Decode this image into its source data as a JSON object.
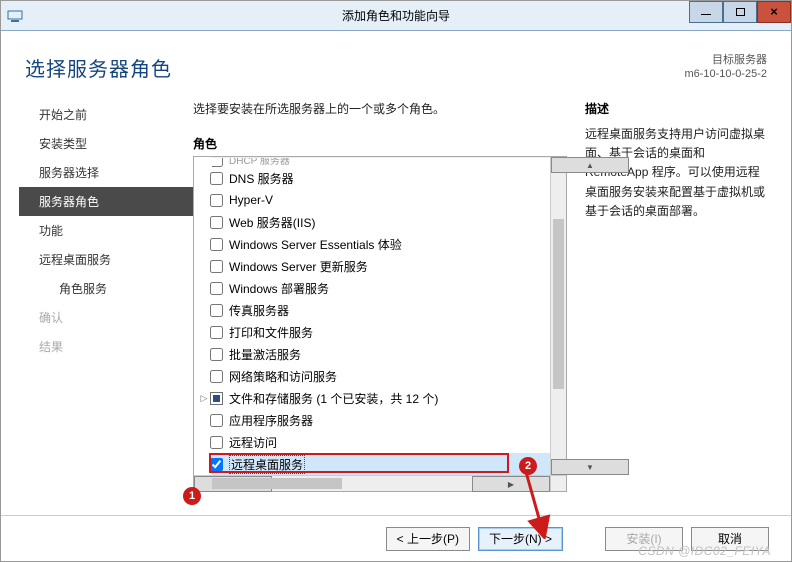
{
  "window": {
    "title": "添加角色和功能向导"
  },
  "page_heading": "选择服务器角色",
  "server_meta": {
    "label": "目标服务器",
    "name": "m6-10-10-0-25-2"
  },
  "nav": {
    "items": [
      {
        "label": "开始之前",
        "state": "normal"
      },
      {
        "label": "安装类型",
        "state": "normal"
      },
      {
        "label": "服务器选择",
        "state": "normal"
      },
      {
        "label": "服务器角色",
        "state": "active"
      },
      {
        "label": "功能",
        "state": "normal"
      },
      {
        "label": "远程桌面服务",
        "state": "normal"
      },
      {
        "label": "角色服务",
        "state": "normal",
        "indent": true
      },
      {
        "label": "确认",
        "state": "disabled"
      },
      {
        "label": "结果",
        "state": "disabled"
      }
    ]
  },
  "main": {
    "intro": "选择要安装在所选服务器上的一个或多个角色。",
    "roles_label": "角色",
    "desc_label": "描述",
    "roles": [
      {
        "label": "DHCP 服务器",
        "checked": false,
        "cut_top": true
      },
      {
        "label": "DNS 服务器",
        "checked": false
      },
      {
        "label": "Hyper-V",
        "checked": false
      },
      {
        "label": "Web 服务器(IIS)",
        "checked": false
      },
      {
        "label": "Windows Server Essentials 体验",
        "checked": false
      },
      {
        "label": "Windows Server 更新服务",
        "checked": false
      },
      {
        "label": "Windows 部署服务",
        "checked": false
      },
      {
        "label": "传真服务器",
        "checked": false
      },
      {
        "label": "打印和文件服务",
        "checked": false
      },
      {
        "label": "批量激活服务",
        "checked": false
      },
      {
        "label": "网络策略和访问服务",
        "checked": false
      },
      {
        "label": "文件和存储服务 (1 个已安装，共 12 个)",
        "checked": "mixed",
        "expander": true
      },
      {
        "label": "应用程序服务器",
        "checked": false
      },
      {
        "label": "远程访问",
        "checked": false
      },
      {
        "label": "远程桌面服务",
        "checked": true,
        "selected": true
      }
    ],
    "description": "远程桌面服务支持用户访问虚拟桌面、基于会话的桌面和 RemoteApp 程序。可以使用远程桌面服务安装来配置基于虚拟机或基于会话的桌面部署。"
  },
  "footer": {
    "prev": "< 上一步(P)",
    "next": "下一步(N) >",
    "install": "安装(I)",
    "cancel": "取消"
  },
  "annotations": {
    "badge1": "1",
    "badge2": "2"
  },
  "watermark": "CSDN @IDC02_FEIYA"
}
